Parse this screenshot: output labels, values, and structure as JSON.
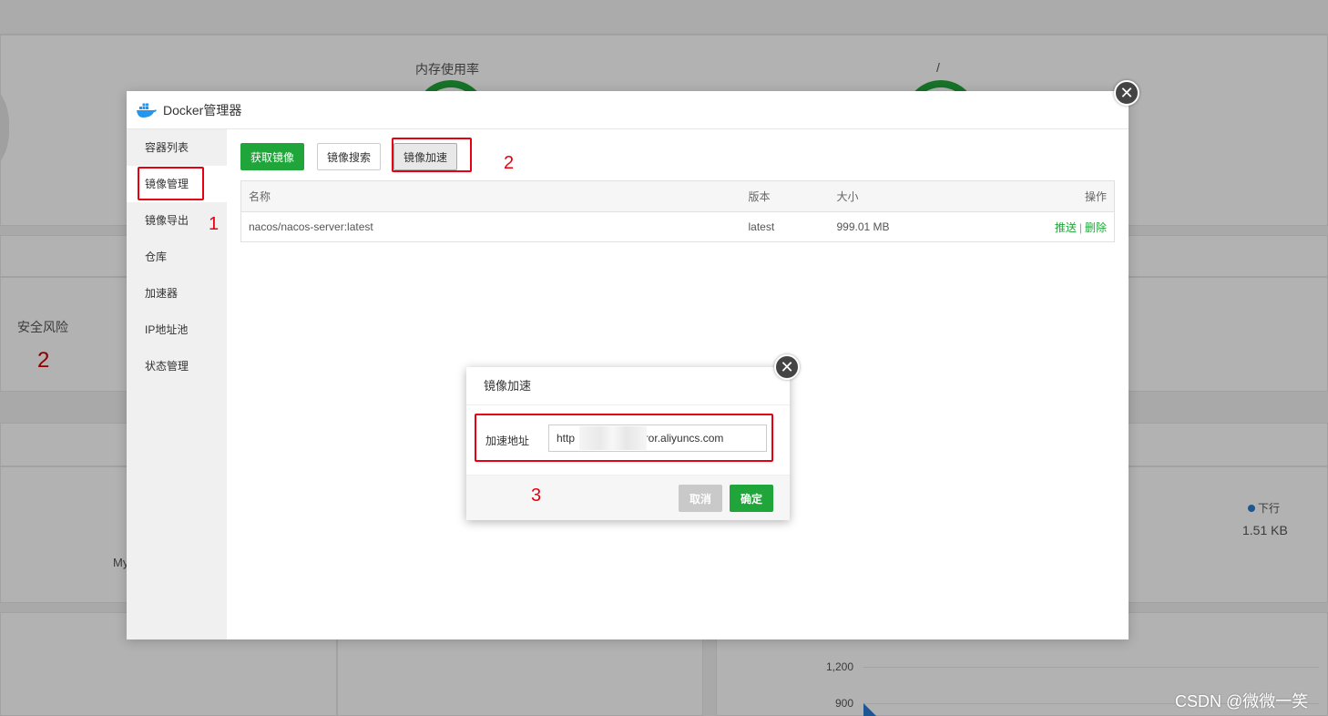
{
  "background": {
    "memory_label": "内存使用率",
    "disk_label": "/",
    "security_label": "安全风险",
    "security_count": "2",
    "network_legend": "下行",
    "network_value": "1.51 KB",
    "truncated_label": "My",
    "chart_ticks": [
      "1,200",
      "900"
    ]
  },
  "docker": {
    "title": "Docker管理器",
    "sidebar": [
      {
        "label": "容器列表"
      },
      {
        "label": "镜像管理"
      },
      {
        "label": "镜像导出"
      },
      {
        "label": "仓库"
      },
      {
        "label": "加速器"
      },
      {
        "label": "IP地址池"
      },
      {
        "label": "状态管理"
      }
    ],
    "toolbar": {
      "pull_label": "获取镜像",
      "search_label": "镜像搜索",
      "accel_label": "镜像加速"
    },
    "table": {
      "headers": [
        "名称",
        "版本",
        "大小",
        "操作"
      ],
      "rows": [
        {
          "name": "nacos/nacos-server:latest",
          "version": "latest",
          "size": "999.01 MB",
          "push": "推送",
          "sep": "|",
          "delete": "删除"
        }
      ]
    }
  },
  "modal": {
    "title": "镜像加速",
    "field_label": "加速地址",
    "field_value": "http                  mirror.aliyuncs.com",
    "cancel_label": "取消",
    "ok_label": "确定"
  },
  "annotations": [
    "1",
    "2",
    "3"
  ],
  "close_glyph": "✕",
  "watermark": "CSDN @微微一笑",
  "colors": {
    "accent_green": "#20a53a",
    "annotation_red": "#e60012"
  }
}
